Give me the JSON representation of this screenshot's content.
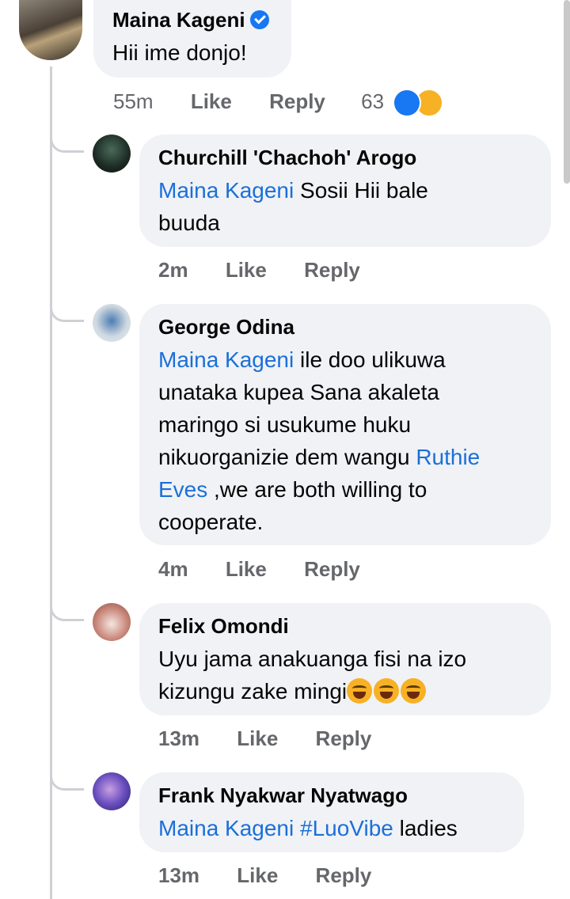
{
  "comment": {
    "author": "Maina Kageni",
    "verified": true,
    "text": "Hii ime donjo!",
    "time": "55m",
    "like_label": "Like",
    "reply_label": "Reply",
    "reaction_count": "63",
    "reactions": [
      "like-icon",
      "haha-icon"
    ]
  },
  "replies": [
    {
      "author": "Churchill 'Chachoh' Arogo",
      "mention": "Maina Kageni",
      "text_lines": [
        " Sosii Hii bale",
        "buuda"
      ],
      "time": "2m",
      "like_label": "Like",
      "reply_label": "Reply"
    },
    {
      "author": "George Odina",
      "mention": "Maina Kageni",
      "line1": " ile doo ulikuwa",
      "line2": "unataka kupea Sana akaleta",
      "line3": "maringo si usukume huku",
      "line4": "nikuorganizie dem wangu ",
      "mention2_part1": "Ruthie",
      "mention2_part2": "Eves",
      "line5": " ,we are both willing to",
      "line6": "cooperate.",
      "time": "4m",
      "like_label": "Like",
      "reply_label": "Reply"
    },
    {
      "author": "Felix Omondi",
      "line1": "Uyu jama anakuanga fisi na izo",
      "line2": "kizungu zake mingi",
      "emojis": [
        "laughing-tears-emoji",
        "laughing-tears-emoji",
        "laughing-tears-emoji"
      ],
      "time": "13m",
      "like_label": "Like",
      "reply_label": "Reply"
    },
    {
      "author": "Frank Nyakwar Nyatwago",
      "mention": "Maina Kageni",
      "hashtag": "#LuoVibe",
      "rest": " ladies",
      "time": "13m",
      "like_label": "Like",
      "reply_label": "Reply"
    }
  ],
  "colors": {
    "bubble": "#f0f2f5",
    "mention": "#1b6fd8",
    "meta": "#65676b",
    "verified": "#1877f2"
  }
}
